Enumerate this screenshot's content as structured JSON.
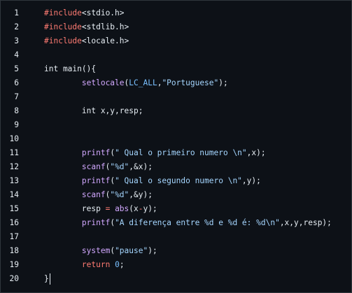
{
  "lines": [
    {
      "n": "1",
      "tokens": [
        {
          "c": "kw",
          "t": "#include"
        },
        {
          "c": "plain",
          "t": "<stdio.h>"
        }
      ]
    },
    {
      "n": "2",
      "tokens": [
        {
          "c": "kw",
          "t": "#include"
        },
        {
          "c": "plain",
          "t": "<stdlib.h>"
        }
      ]
    },
    {
      "n": "3",
      "tokens": [
        {
          "c": "kw",
          "t": "#include"
        },
        {
          "c": "plain",
          "t": "<locale.h>"
        }
      ]
    },
    {
      "n": "4",
      "tokens": []
    },
    {
      "n": "5",
      "tokens": [
        {
          "c": "plain",
          "t": "int main(){"
        }
      ]
    },
    {
      "n": "6",
      "tokens": [
        {
          "c": "plain",
          "t": "        "
        },
        {
          "c": "fn",
          "t": "setlocale"
        },
        {
          "c": "plain",
          "t": "("
        },
        {
          "c": "const",
          "t": "LC_ALL"
        },
        {
          "c": "plain",
          "t": ","
        },
        {
          "c": "str",
          "t": "\"Portuguese\""
        },
        {
          "c": "plain",
          "t": ");"
        }
      ]
    },
    {
      "n": "7",
      "tokens": []
    },
    {
      "n": "8",
      "tokens": [
        {
          "c": "plain",
          "t": "        int x,y,resp;"
        }
      ]
    },
    {
      "n": "9",
      "tokens": []
    },
    {
      "n": "10",
      "tokens": []
    },
    {
      "n": "11",
      "tokens": [
        {
          "c": "plain",
          "t": "        "
        },
        {
          "c": "fn",
          "t": "printf"
        },
        {
          "c": "plain",
          "t": "("
        },
        {
          "c": "str",
          "t": "\" Qual o primeiro numero \\n\""
        },
        {
          "c": "plain",
          "t": ",x);"
        }
      ]
    },
    {
      "n": "12",
      "tokens": [
        {
          "c": "plain",
          "t": "        "
        },
        {
          "c": "fn",
          "t": "scanf"
        },
        {
          "c": "plain",
          "t": "("
        },
        {
          "c": "str",
          "t": "\"%d\""
        },
        {
          "c": "plain",
          "t": ",&x);"
        }
      ]
    },
    {
      "n": "13",
      "tokens": [
        {
          "c": "plain",
          "t": "        "
        },
        {
          "c": "fn",
          "t": "printf"
        },
        {
          "c": "plain",
          "t": "("
        },
        {
          "c": "str",
          "t": "\" Qual o segundo numero \\n\""
        },
        {
          "c": "plain",
          "t": ",y);"
        }
      ]
    },
    {
      "n": "14",
      "tokens": [
        {
          "c": "plain",
          "t": "        "
        },
        {
          "c": "fn",
          "t": "scanf"
        },
        {
          "c": "plain",
          "t": "("
        },
        {
          "c": "str",
          "t": "\"%d\""
        },
        {
          "c": "plain",
          "t": ",&y);"
        }
      ]
    },
    {
      "n": "15",
      "tokens": [
        {
          "c": "plain",
          "t": "        resp "
        },
        {
          "c": "kw",
          "t": "="
        },
        {
          "c": "plain",
          "t": " "
        },
        {
          "c": "fn",
          "t": "abs"
        },
        {
          "c": "plain",
          "t": "(x"
        },
        {
          "c": "kw",
          "t": "-"
        },
        {
          "c": "plain",
          "t": "y);"
        }
      ]
    },
    {
      "n": "16",
      "tokens": [
        {
          "c": "plain",
          "t": "        "
        },
        {
          "c": "fn",
          "t": "printf"
        },
        {
          "c": "plain",
          "t": "("
        },
        {
          "c": "str",
          "t": "\"A diferença entre %d e %d é: %d\\n\""
        },
        {
          "c": "plain",
          "t": ",x,y,resp);"
        }
      ]
    },
    {
      "n": "17",
      "tokens": []
    },
    {
      "n": "18",
      "tokens": [
        {
          "c": "plain",
          "t": "        "
        },
        {
          "c": "fn",
          "t": "system"
        },
        {
          "c": "plain",
          "t": "("
        },
        {
          "c": "str",
          "t": "\"pause\""
        },
        {
          "c": "plain",
          "t": ");"
        }
      ]
    },
    {
      "n": "19",
      "tokens": [
        {
          "c": "plain",
          "t": "        "
        },
        {
          "c": "kw",
          "t": "return"
        },
        {
          "c": "plain",
          "t": " "
        },
        {
          "c": "num",
          "t": "0"
        },
        {
          "c": "plain",
          "t": ";"
        }
      ]
    },
    {
      "n": "20",
      "tokens": [
        {
          "c": "plain",
          "t": "}"
        }
      ],
      "cursor": true
    }
  ],
  "colors": {
    "background": "#0d1117",
    "keyword": "#ff7b72",
    "function": "#d2a8ff",
    "constant": "#79c0ff",
    "string": "#a5d6ff",
    "text": "#e6edf3"
  }
}
